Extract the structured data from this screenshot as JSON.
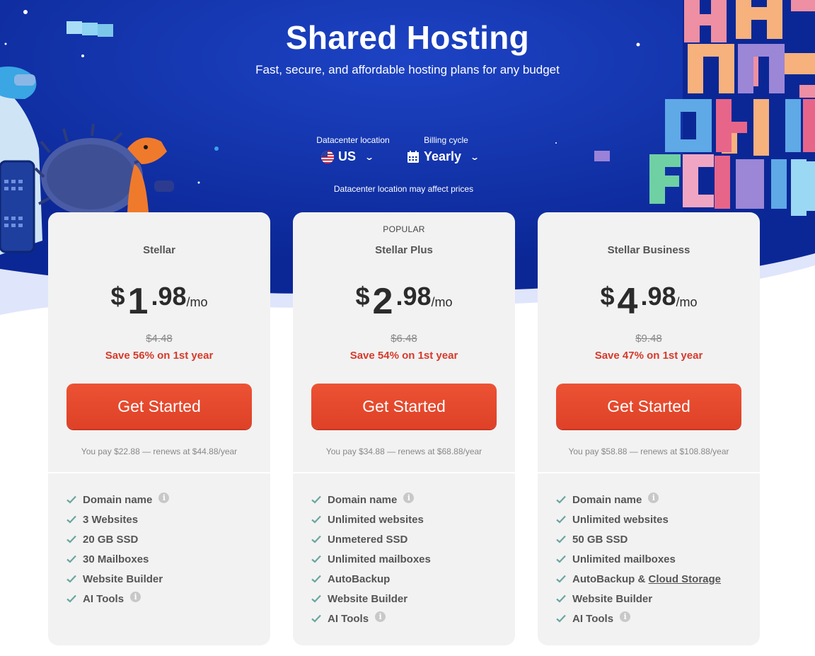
{
  "header": {
    "title": "Shared Hosting",
    "subtitle": "Fast, secure, and affordable hosting plans for any budget"
  },
  "controls": {
    "datacenter": {
      "label": "Datacenter location",
      "value": "US"
    },
    "billing": {
      "label": "Billing cycle",
      "value": "Yearly"
    },
    "note": "Datacenter location may affect prices"
  },
  "colors": {
    "hero_blue": "#0d2ea0",
    "cta": "#e64a2e",
    "save_text": "#d63a2a",
    "card_bg": "#f2f2f2",
    "check": "#6aa5a0"
  },
  "plans": [
    {
      "badge": "",
      "name": "Stellar",
      "currency": "$",
      "dollars": "1",
      "cents": ".98",
      "per": "/mo",
      "old_price": "$4.48",
      "save": "Save 56% on 1st year",
      "cta": "Get Started",
      "renew": "You pay $22.88 — renews at $44.88/year",
      "features": [
        "Domain name",
        "3 Websites",
        "20 GB SSD",
        "30 Mailboxes",
        "Website Builder",
        "AI Tools"
      ]
    },
    {
      "badge": "POPULAR",
      "name": "Stellar Plus",
      "currency": "$",
      "dollars": "2",
      "cents": ".98",
      "per": "/mo",
      "old_price": "$6.48",
      "save": "Save 54% on 1st year",
      "cta": "Get Started",
      "renew": "You pay $34.88 — renews at $68.88/year",
      "features": [
        "Domain name",
        "Unlimited websites",
        "Unmetered SSD",
        "Unlimited mailboxes",
        "AutoBackup",
        "Website Builder",
        "AI Tools"
      ]
    },
    {
      "badge": "",
      "name": "Stellar Business",
      "currency": "$",
      "dollars": "4",
      "cents": ".98",
      "per": "/mo",
      "old_price": "$9.48",
      "save": "Save 47% on 1st year",
      "cta": "Get Started",
      "renew": "You pay $58.88 — renews at $108.88/year",
      "features": [
        "Domain name",
        "Unlimited websites",
        "50 GB SSD",
        "Unlimited mailboxes",
        "AutoBackup & ",
        "Website Builder",
        "AI Tools"
      ],
      "feature_link": "Cloud Storage"
    }
  ],
  "icons": {
    "info": "info-icon",
    "check": "check-icon",
    "chevron": "chevron-down-icon",
    "flag": "us-flag-icon",
    "calendar": "calendar-icon"
  }
}
